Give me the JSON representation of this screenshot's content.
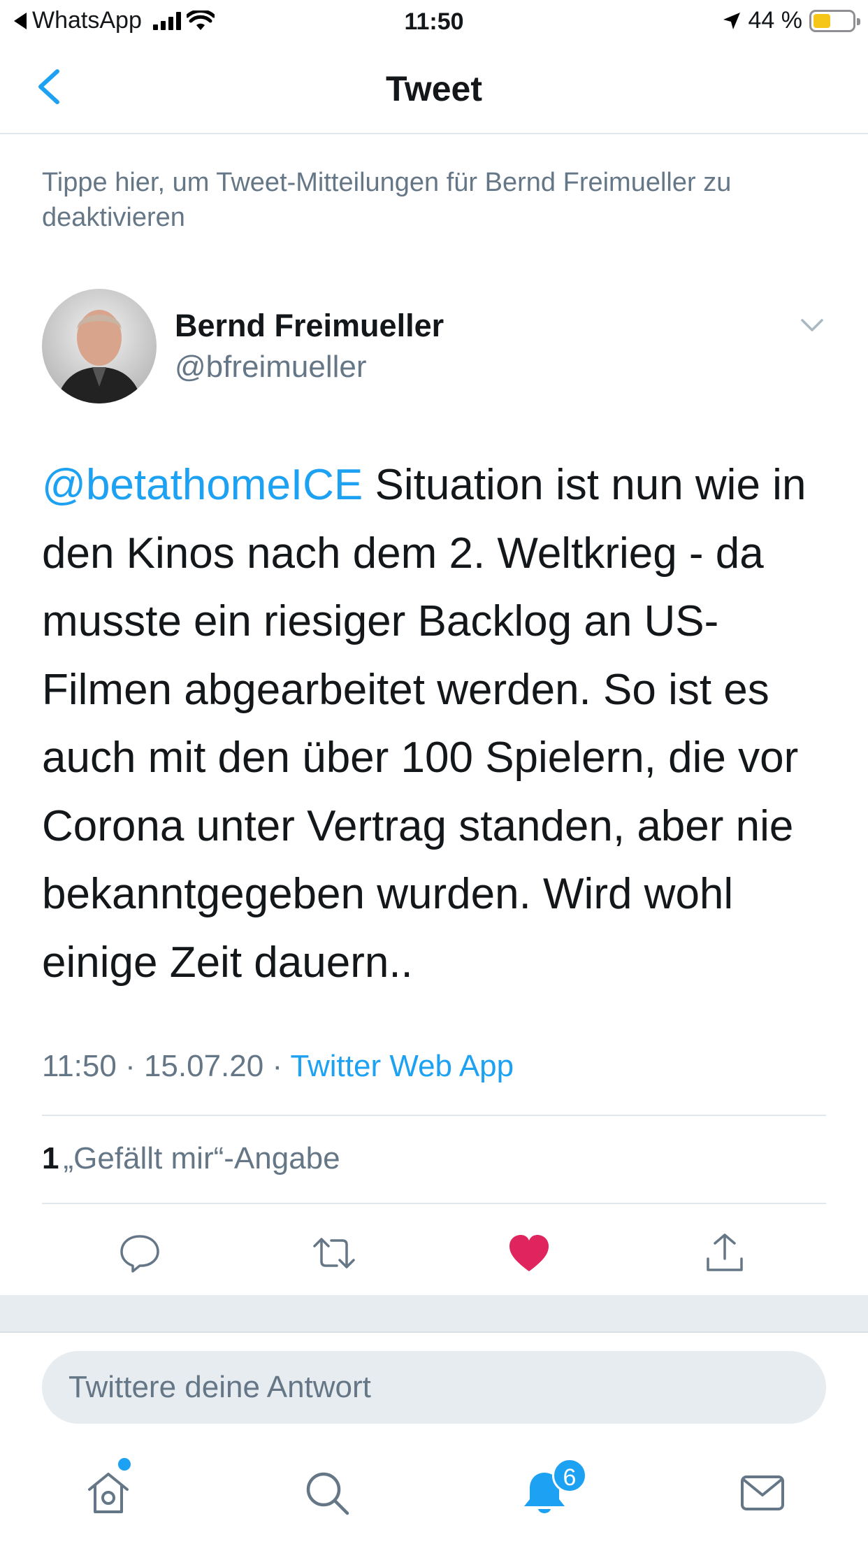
{
  "status_bar": {
    "back_app": "WhatsApp",
    "time": "11:50",
    "battery_percent": "44 %",
    "battery_level": 0.44
  },
  "nav": {
    "title": "Tweet"
  },
  "notification_hint": "Tippe hier, um Tweet-Mitteilungen für Bernd Freimueller zu deaktivieren",
  "author": {
    "name": "Bernd Freimueller",
    "handle": "@bfreimueller"
  },
  "tweet": {
    "mention": "@betathomeICE",
    "text": " Situation ist nun wie in den Kinos nach dem 2. Weltkrieg - da musste ein riesiger Backlog an US-Filmen abgearbeitet werden. So ist es auch mit den über 100 Spielern, die vor Corona unter Vertrag standen, aber nie bekanntgegeben wurden. Wird wohl einige Zeit dauern..",
    "time": "11:50",
    "separator": " · ",
    "date": "15.07.20",
    "source": "Twitter Web App"
  },
  "stats": {
    "like_count": "1",
    "like_label": "„Gefällt mir“-Angabe"
  },
  "actions": {
    "reply_icon": "reply-icon",
    "retweet_icon": "retweet-icon",
    "like_icon": "heart-icon",
    "share_icon": "share-icon",
    "liked": true
  },
  "reply": {
    "placeholder": "Twittere deine Antwort"
  },
  "tab_bar": {
    "notifications_badge": "6"
  },
  "colors": {
    "accent": "#1da1f2",
    "like": "#e0245e",
    "secondary_text": "#657786"
  }
}
